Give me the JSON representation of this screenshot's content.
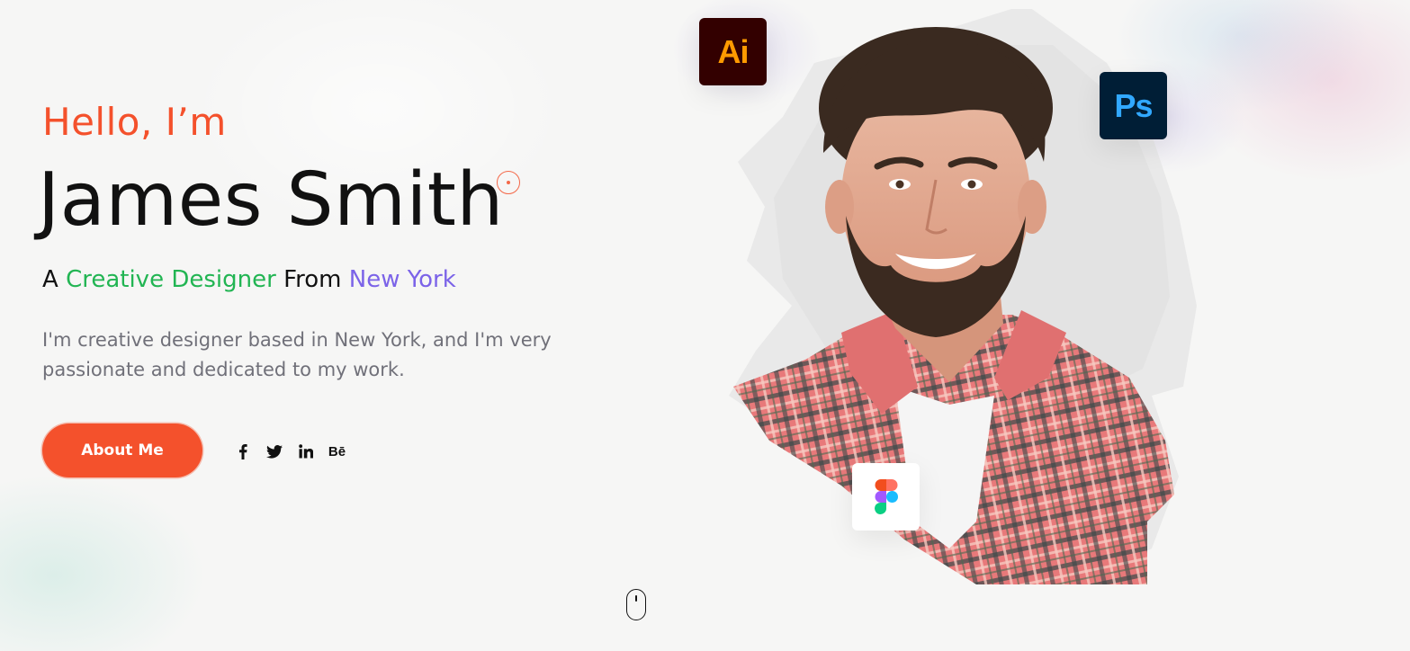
{
  "hero": {
    "greeting": "Hello, I’m",
    "name": "James Smith",
    "tagline": {
      "prefix": "A",
      "role": "Creative Designer",
      "middle": "From",
      "city": "New York"
    },
    "bio": "I'm creative designer based in New York, and I'm very passionate and dedicated to my work.",
    "button_label": "About Me"
  },
  "social": [
    {
      "name": "facebook",
      "icon": "facebook-icon"
    },
    {
      "name": "twitter",
      "icon": "twitter-icon"
    },
    {
      "name": "linkedin",
      "icon": "linkedin-icon"
    },
    {
      "name": "behance",
      "icon": "behance-icon",
      "label": "Bē"
    }
  ],
  "skills": {
    "illustrator": "Ai",
    "photoshop": "Ps",
    "figma": "figma-icon"
  },
  "colors": {
    "accent": "#f4512c",
    "green": "#22b553",
    "purple": "#7b63e8",
    "text": "#111111",
    "muted": "#707079",
    "illustrator_bg": "#330000",
    "illustrator_fg": "#ff9a00",
    "photoshop_bg": "#001e36",
    "photoshop_fg": "#31a8ff"
  }
}
